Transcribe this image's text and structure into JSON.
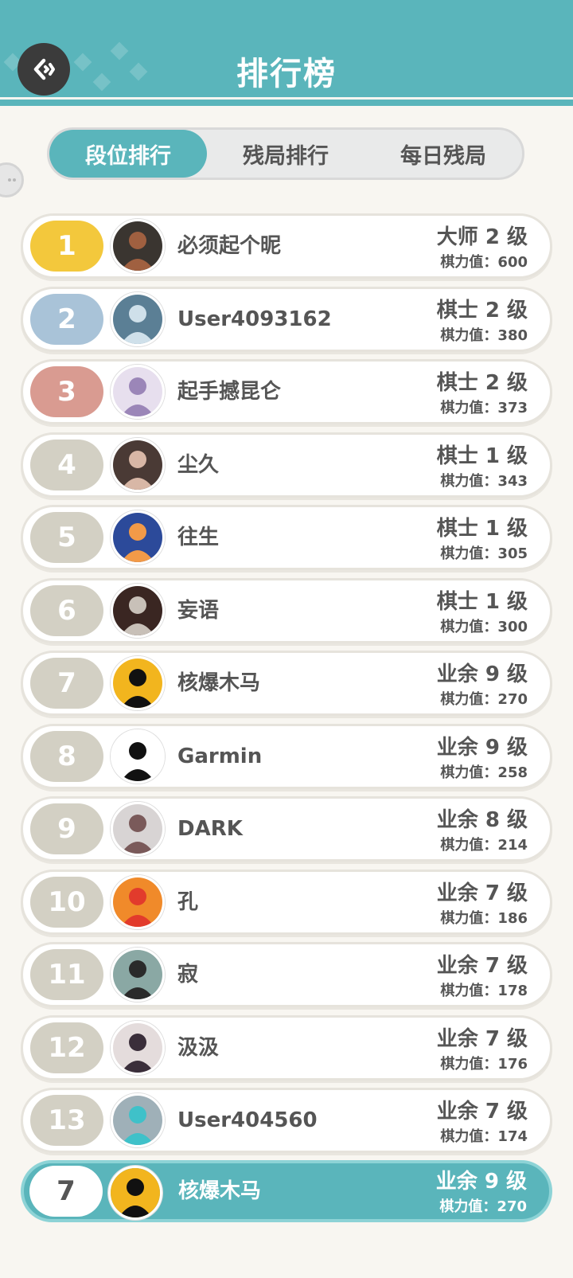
{
  "header": {
    "title": "排行榜"
  },
  "tabs": [
    {
      "label": "段位排行",
      "active": true
    },
    {
      "label": "残局排行",
      "active": false
    },
    {
      "label": "每日残局",
      "active": false
    }
  ],
  "rankings": [
    {
      "rank": "1",
      "name": "必须起个昵",
      "level": "大师 2 级",
      "power": "棋力值：600",
      "rank_color": "#f3c83c",
      "avatar_color": "#3a3530",
      "avatar_accent": "#a06040"
    },
    {
      "rank": "2",
      "name": "User4093162",
      "level": "棋士 2 级",
      "power": "棋力值：380",
      "rank_color": "#a9c3d8",
      "avatar_color": "#5b7f95",
      "avatar_accent": "#cfe0ea"
    },
    {
      "rank": "3",
      "name": "起手撼昆仑",
      "level": "棋士 2 级",
      "power": "棋力值：373",
      "rank_color": "#d99b91",
      "avatar_color": "#e7dfee",
      "avatar_accent": "#9b86b8"
    },
    {
      "rank": "4",
      "name": "尘久",
      "level": "棋士 1 级",
      "power": "棋力值：343",
      "rank_color": "#d3d0c4",
      "avatar_color": "#4a3a35",
      "avatar_accent": "#d8b7a6"
    },
    {
      "rank": "5",
      "name": "往生",
      "level": "棋士 1 级",
      "power": "棋力值：305",
      "rank_color": "#d3d0c4",
      "avatar_color": "#2c4a9a",
      "avatar_accent": "#f29a48"
    },
    {
      "rank": "6",
      "name": "妄语",
      "level": "棋士 1 级",
      "power": "棋力值：300",
      "rank_color": "#d3d0c4",
      "avatar_color": "#3a2622",
      "avatar_accent": "#c8c0b8"
    },
    {
      "rank": "7",
      "name": "核爆木马",
      "level": "业余 9 级",
      "power": "棋力值：270",
      "rank_color": "#d3d0c4",
      "avatar_color": "#f2b51e",
      "avatar_accent": "#111111"
    },
    {
      "rank": "8",
      "name": "Garmin",
      "level": "业余 9 级",
      "power": "棋力值：258",
      "rank_color": "#d3d0c4",
      "avatar_color": "#ffffff",
      "avatar_accent": "#111111"
    },
    {
      "rank": "9",
      "name": "DARK",
      "level": "业余 8 级",
      "power": "棋力值：214",
      "rank_color": "#d3d0c4",
      "avatar_color": "#d8d4d4",
      "avatar_accent": "#7a5a5a"
    },
    {
      "rank": "10",
      "name": "孔",
      "level": "业余 7 级",
      "power": "棋力值：186",
      "rank_color": "#d3d0c4",
      "avatar_color": "#f08a2a",
      "avatar_accent": "#e23b2c"
    },
    {
      "rank": "11",
      "name": "寂",
      "level": "业余 7 级",
      "power": "棋力值：178",
      "rank_color": "#d3d0c4",
      "avatar_color": "#8aa8a4",
      "avatar_accent": "#2a2a2a"
    },
    {
      "rank": "12",
      "name": "汲汲",
      "level": "业余 7 级",
      "power": "棋力值：176",
      "rank_color": "#d3d0c4",
      "avatar_color": "#e4dcdc",
      "avatar_accent": "#3a2e3a"
    },
    {
      "rank": "13",
      "name": "User404560",
      "level": "业余 7 级",
      "power": "棋力值：174",
      "rank_color": "#d3d0c4",
      "avatar_color": "#9fb0b8",
      "avatar_accent": "#3fc1c9"
    }
  ],
  "me": {
    "rank": "7",
    "name": "核爆木马",
    "level": "业余 9 级",
    "power": "棋力值：270",
    "avatar_color": "#f2b51e",
    "avatar_accent": "#111111"
  },
  "colors": {
    "accent": "#5ab5bb",
    "text": "#555555",
    "background": "#f8f6f1"
  }
}
